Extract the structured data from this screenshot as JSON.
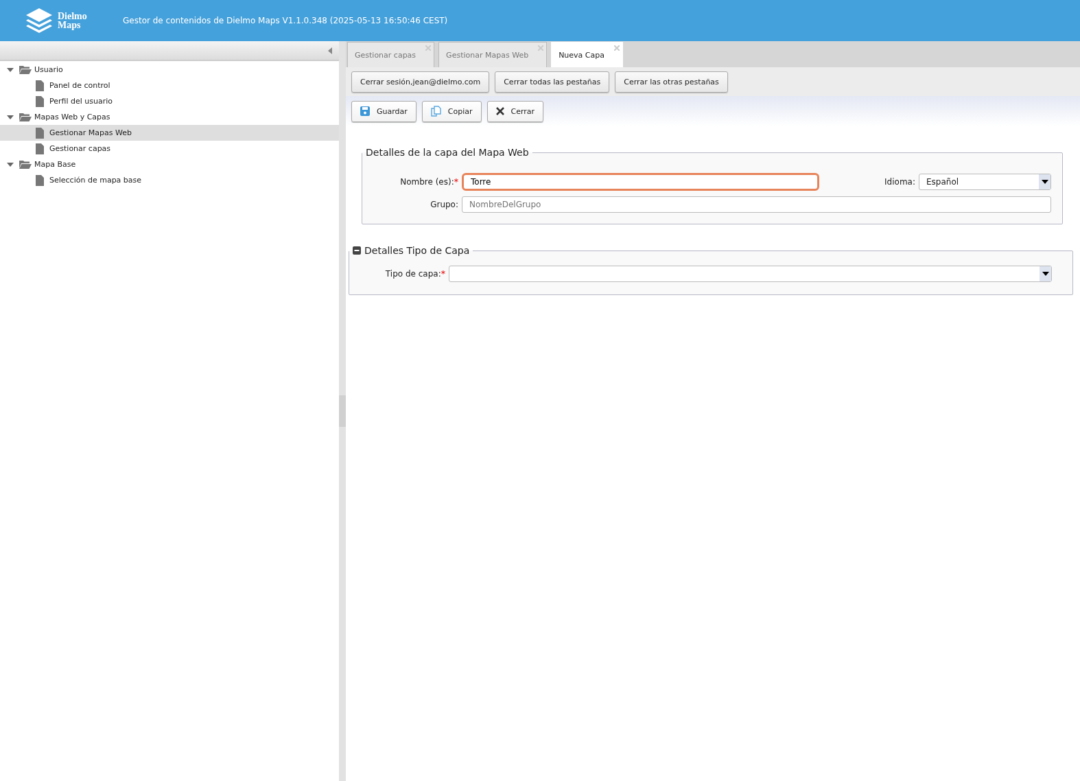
{
  "header": {
    "logo_lines": [
      "Dielmo",
      "Maps"
    ],
    "title": "Gestor de contenidos de Dielmo Maps V1.1.0.348 (2025-05-13 16:50:46 CEST)"
  },
  "sidebar": {
    "tree": [
      {
        "label": "Usuario",
        "expanded": true,
        "selected": false,
        "children": [
          {
            "label": "Panel de control",
            "selected": false
          },
          {
            "label": "Perfil del usuario",
            "selected": false
          }
        ]
      },
      {
        "label": "Mapas Web y Capas",
        "expanded": true,
        "selected": false,
        "children": [
          {
            "label": "Gestionar Mapas Web",
            "selected": true
          },
          {
            "label": "Gestionar capas",
            "selected": false
          }
        ]
      },
      {
        "label": "Mapa Base",
        "expanded": true,
        "selected": false,
        "children": [
          {
            "label": "Selección de mapa base",
            "selected": false
          }
        ]
      }
    ]
  },
  "tabs": [
    {
      "label": "Gestionar capas",
      "selected": false
    },
    {
      "label": "Gestionar Mapas Web",
      "selected": false
    },
    {
      "label": "Nueva Capa",
      "selected": true
    }
  ],
  "session_buttons": [
    "Cerrar sesión,jean@dielmo.com",
    "Cerrar todas las pestañas",
    "Cerrar las otras pestañas"
  ],
  "toolbar": [
    {
      "label": "Guardar",
      "kind": "save"
    },
    {
      "label": "Copiar",
      "kind": "copy"
    },
    {
      "label": "Cerrar",
      "kind": "close"
    }
  ],
  "layer_details": {
    "title": "Detalles de la capa del Mapa Web",
    "name": {
      "label": "Nombre (es):",
      "required_mark": "*",
      "value": "Torre",
      "focused": true
    },
    "language": {
      "label": "Idioma:",
      "value": "Español"
    },
    "group": {
      "label": "Grupo:",
      "placeholder": "NombreDelGrupo"
    }
  },
  "type_details": {
    "title": "Detalles Tipo de Capa",
    "expanded": true,
    "layer_type": {
      "label": "Tipo de capa:",
      "required_mark": "*"
    }
  }
}
